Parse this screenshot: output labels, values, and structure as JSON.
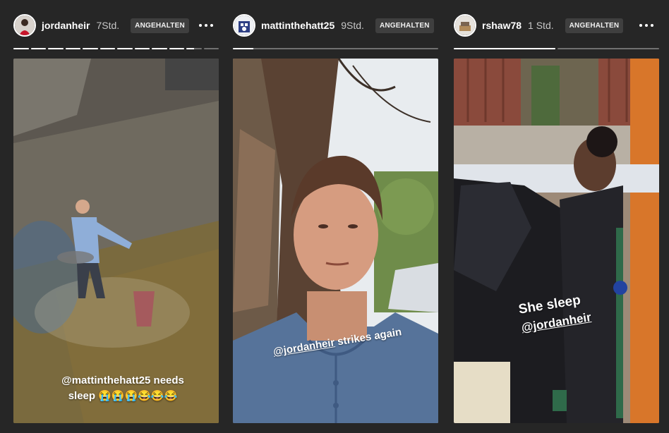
{
  "stories": [
    {
      "username": "jordanheir",
      "time": "7Std.",
      "status": "ANGEHALTEN",
      "segments": [
        1,
        1,
        1,
        1,
        1,
        1,
        1,
        1,
        1,
        1,
        0.5,
        0
      ],
      "caption_line1": "@mattinthehatt25 needs",
      "caption_line2": "sleep 😭😭😭😂😂😂"
    },
    {
      "username": "mattinthehatt25",
      "time": "9Std.",
      "status": "ANGEHALTEN",
      "segments": [
        0.1
      ],
      "caption_mention": "@jordanheir",
      "caption_rest": " strikes again"
    },
    {
      "username": "rshaw78",
      "time": "1 Std.",
      "status": "ANGEHALTEN",
      "segments": [
        1,
        0
      ],
      "caption_line1": "She sleep",
      "caption_mention": "@jordanheir"
    }
  ]
}
